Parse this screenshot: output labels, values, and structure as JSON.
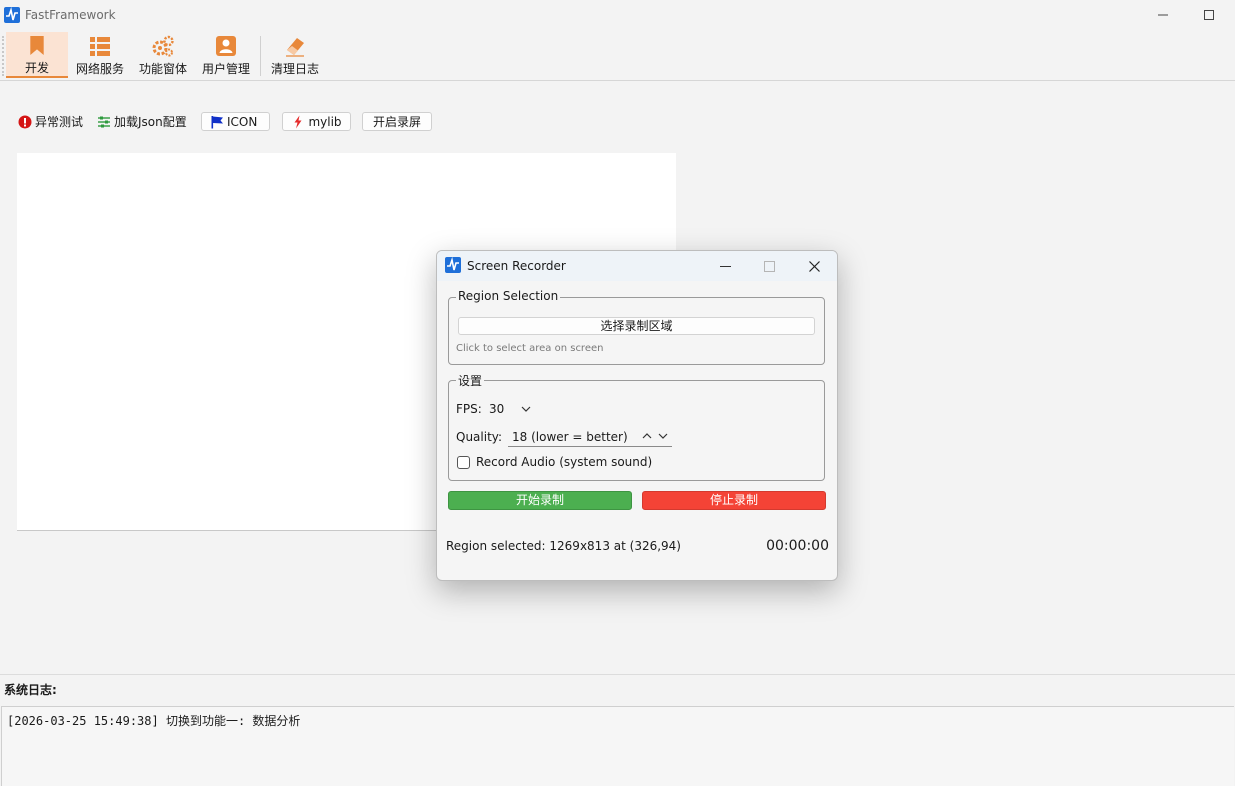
{
  "app": {
    "title": "FastFramework",
    "accent": "#e8883a",
    "logo_color": "#1e6fd9"
  },
  "ribbon": {
    "items": [
      {
        "label": "开发",
        "icon": "bookmark-icon",
        "active": true
      },
      {
        "label": "网络服务",
        "icon": "list-icon"
      },
      {
        "label": "功能窗体",
        "icon": "gears-icon"
      },
      {
        "label": "用户管理",
        "icon": "user-card-icon"
      },
      {
        "label": "清理日志",
        "icon": "eraser-icon"
      }
    ]
  },
  "toolbar": {
    "exception_test": "异常测试",
    "load_json": "加载Json配置",
    "icon_btn": "ICON",
    "mylib": "mylib",
    "start_screen_record": "开启录屏"
  },
  "log": {
    "label": "系统日志:",
    "lines": [
      "[2026-03-25 15:49:38] 切换到功能一: 数据分析"
    ]
  },
  "recorder": {
    "title": "Screen Recorder",
    "region_group": "Region Selection",
    "select_region_button": "选择录制区域",
    "hint": "Click to select area on screen",
    "settings_group": "设置",
    "fps_label": "FPS:",
    "fps_value": "30",
    "quality_label": "Quality:",
    "quality_value": "18 (lower = better)",
    "audio_label": "Record Audio (system sound)",
    "audio_checked": false,
    "start_button": "开始录制",
    "stop_button": "停止录制",
    "status": "Region selected: 1269x813 at (326,94)",
    "timer": "00:00:00",
    "start_color": "#4caf50",
    "stop_color": "#f44336"
  }
}
